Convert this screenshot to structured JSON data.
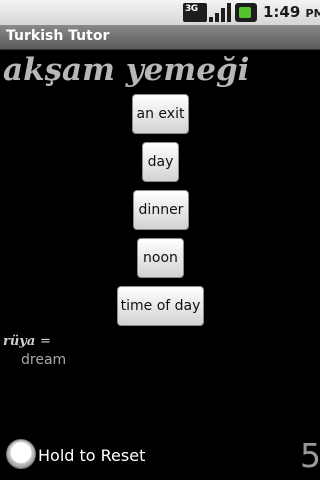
{
  "status_bar": {
    "network_label": "3G",
    "network_icon": "3g-data-icon",
    "signal_icon": "signal-strength-icon",
    "battery_icon": "battery-charging-icon",
    "time": "1:49",
    "ampm": "PM"
  },
  "app": {
    "title": "Turkish Tutor"
  },
  "quiz": {
    "word": "akşam yemeği",
    "choices": [
      "an exit",
      "day",
      "dinner",
      "noon",
      "time of day"
    ]
  },
  "previous": {
    "word": "rüya",
    "equals": "=",
    "meaning": "dream"
  },
  "footer": {
    "reset_label": "Hold to Reset",
    "reset_icon": "reset-knob-icon",
    "score": "5"
  },
  "colors": {
    "background": "#000000",
    "word": "#b7b7b7",
    "titlebar": "#6e6e6e"
  }
}
